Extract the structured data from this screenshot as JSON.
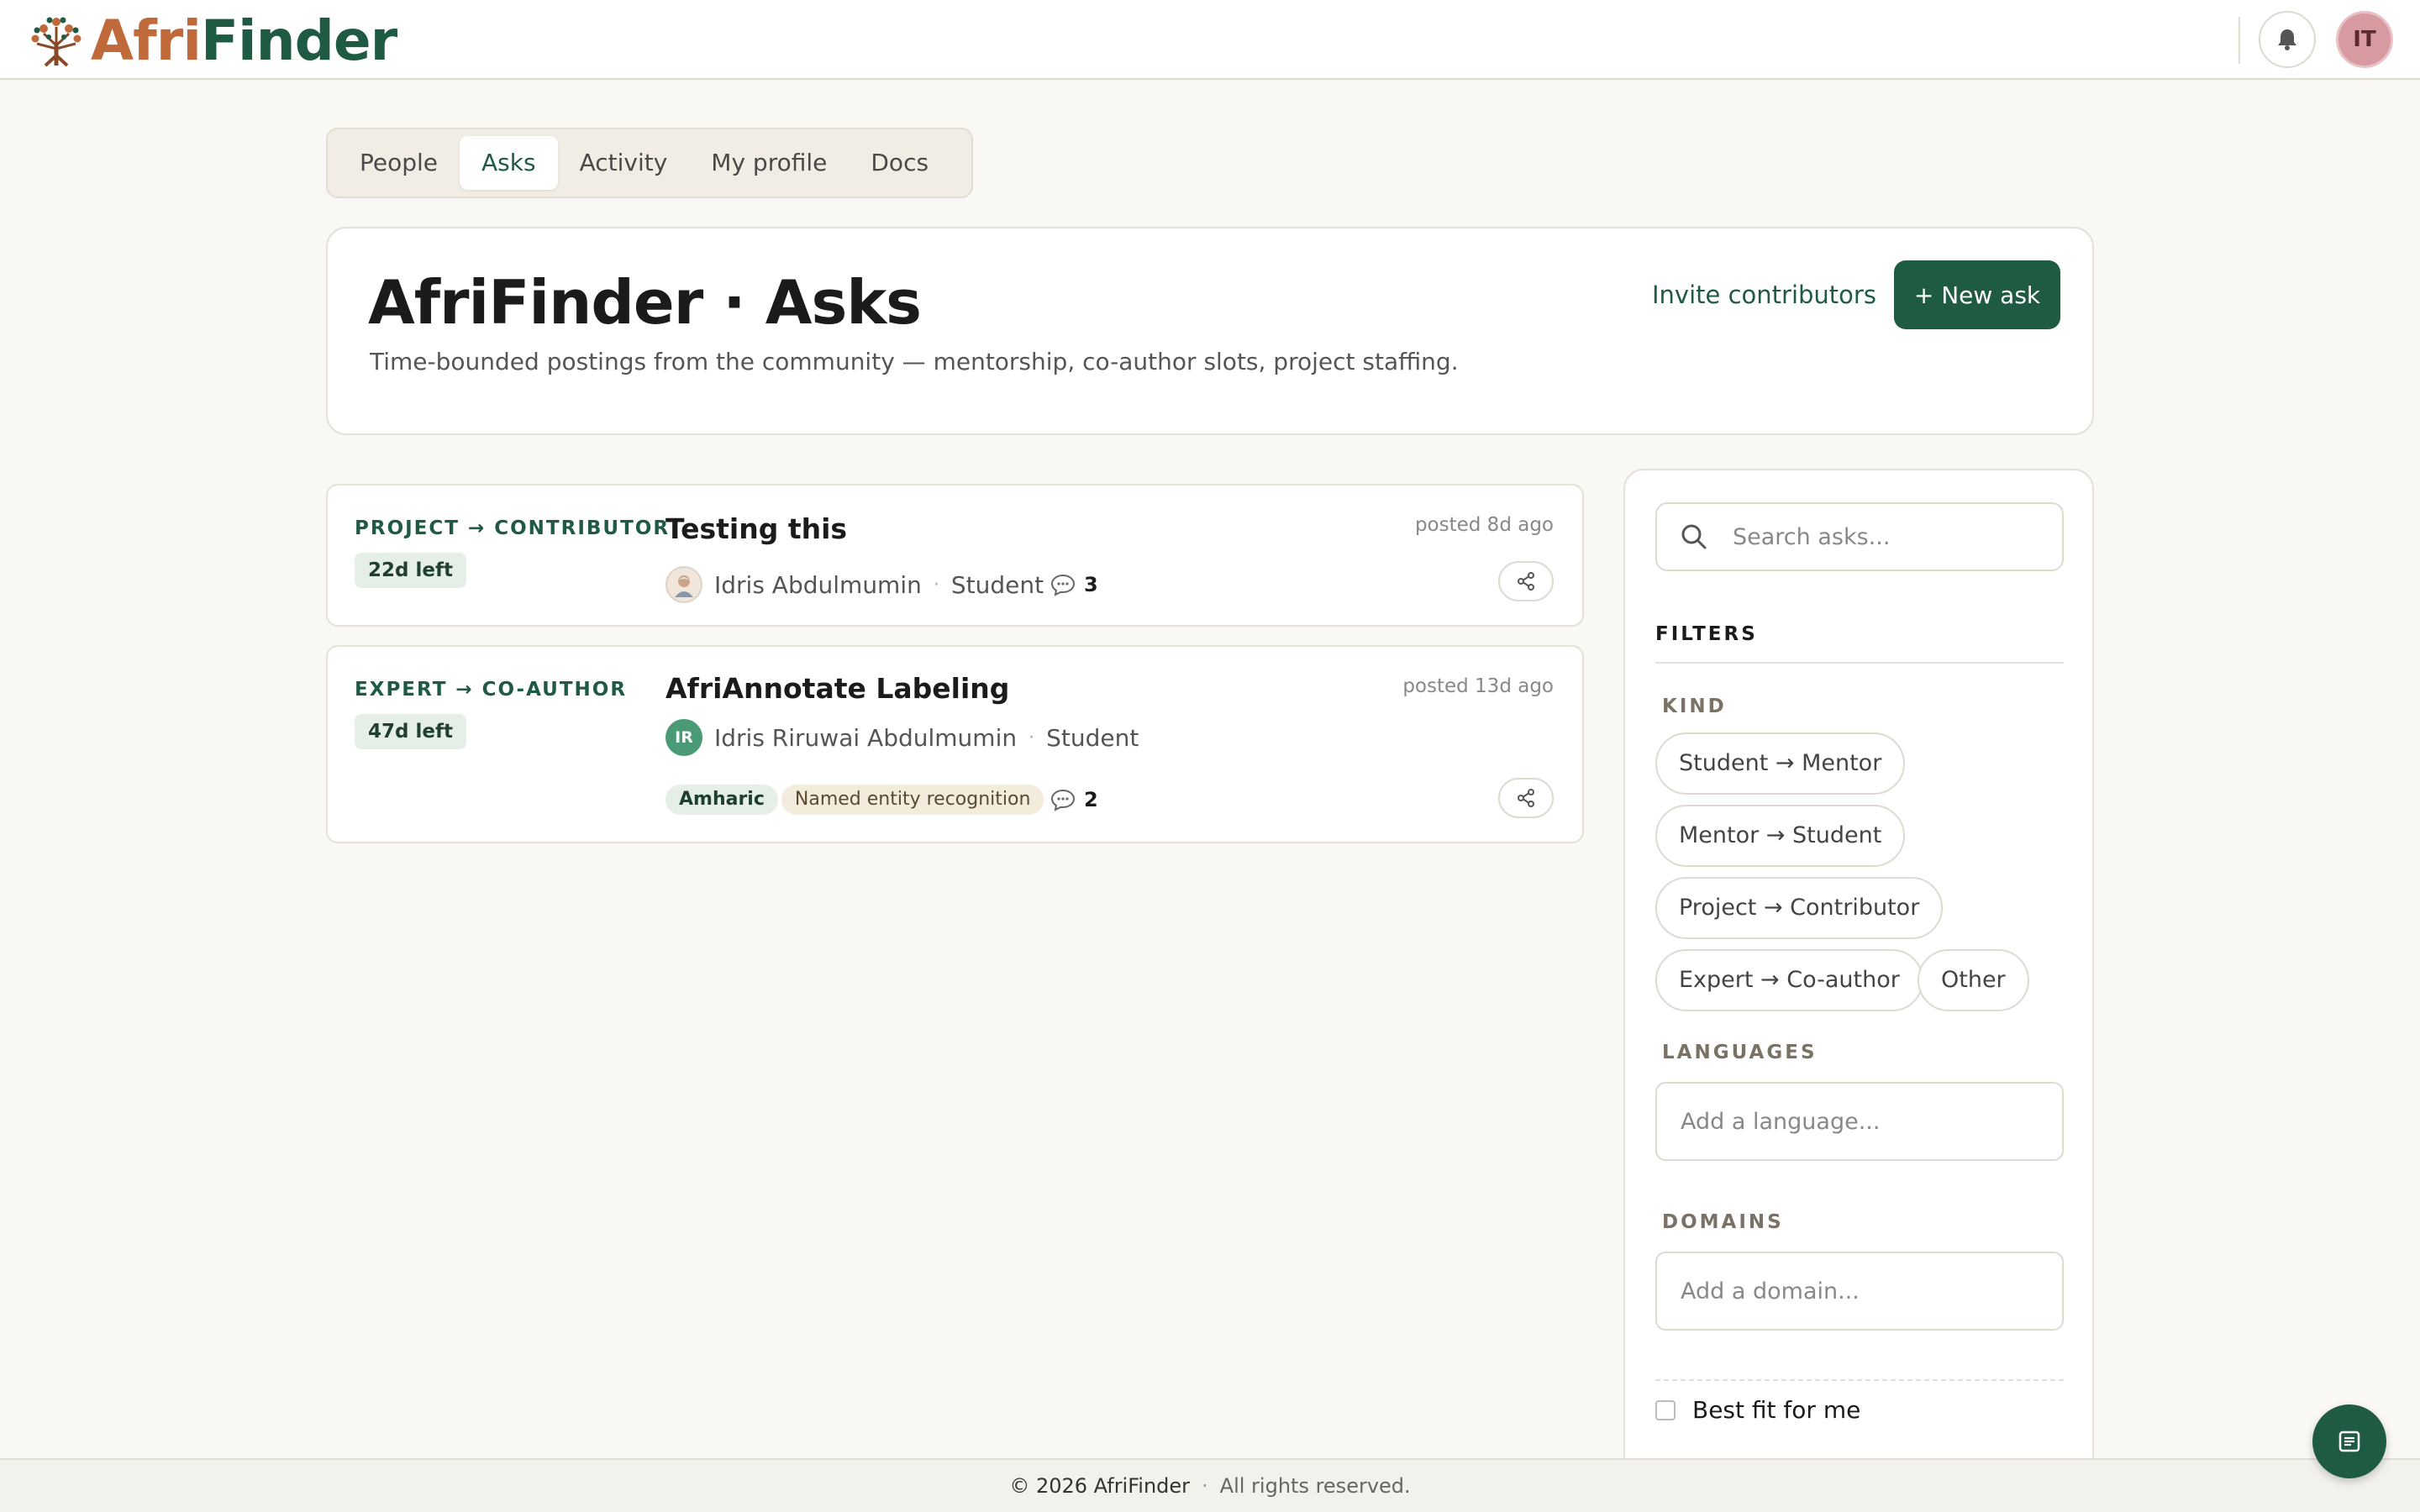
{
  "brand": {
    "part1": "Afri",
    "part2": "Finder"
  },
  "header": {
    "user_initials": "IT",
    "bell_icon": "bell-icon"
  },
  "tabs": [
    {
      "label": "People",
      "active": false
    },
    {
      "label": "Asks",
      "active": true
    },
    {
      "label": "Activity",
      "active": false
    },
    {
      "label": "My profile",
      "active": false
    },
    {
      "label": "Docs",
      "active": false
    }
  ],
  "hero": {
    "title": "AfriFinder · Asks",
    "subtitle": "Time-bounded postings from the community — mentorship, co-author slots, project staffing.",
    "invite_label": "Invite contributors",
    "new_ask_label": "+ New ask"
  },
  "asks": [
    {
      "kind": "PROJECT → CONTRIBUTOR",
      "time_left": "22d left",
      "title": "Testing this",
      "posted": "posted 8d ago",
      "author": "Idris Abdulmumin",
      "role": "Student",
      "comments": "3"
    },
    {
      "kind": "EXPERT → CO-AUTHOR",
      "time_left": "47d left",
      "title": "AfriAnnotate Labeling",
      "posted": "posted 13d ago",
      "author_initials": "IR",
      "author": "Idris Riruwai Abdulmumin",
      "role": "Student",
      "tags": [
        "Amharic",
        "Named entity recognition"
      ],
      "comments": "2"
    }
  ],
  "sidebar": {
    "search_placeholder": "Search asks...",
    "filters_heading": "FILTERS",
    "kind_label": "KIND",
    "kinds": [
      "Student → Mentor",
      "Mentor → Student",
      "Project → Contributor",
      "Expert → Co-author",
      "Other"
    ],
    "languages_label": "LANGUAGES",
    "languages_placeholder": "Add a language...",
    "domains_label": "DOMAINS",
    "domains_placeholder": "Add a domain...",
    "best_fit_label": "Best fit for me"
  },
  "footer": {
    "copyright": "© 2026 AfriFinder",
    "separator": "·",
    "rights": "All rights reserved."
  },
  "colors": {
    "brand_green": "#1f5a43",
    "brand_orange": "#c0693b",
    "background": "#faf8f4",
    "avatar_pink": "#d69aa0"
  }
}
